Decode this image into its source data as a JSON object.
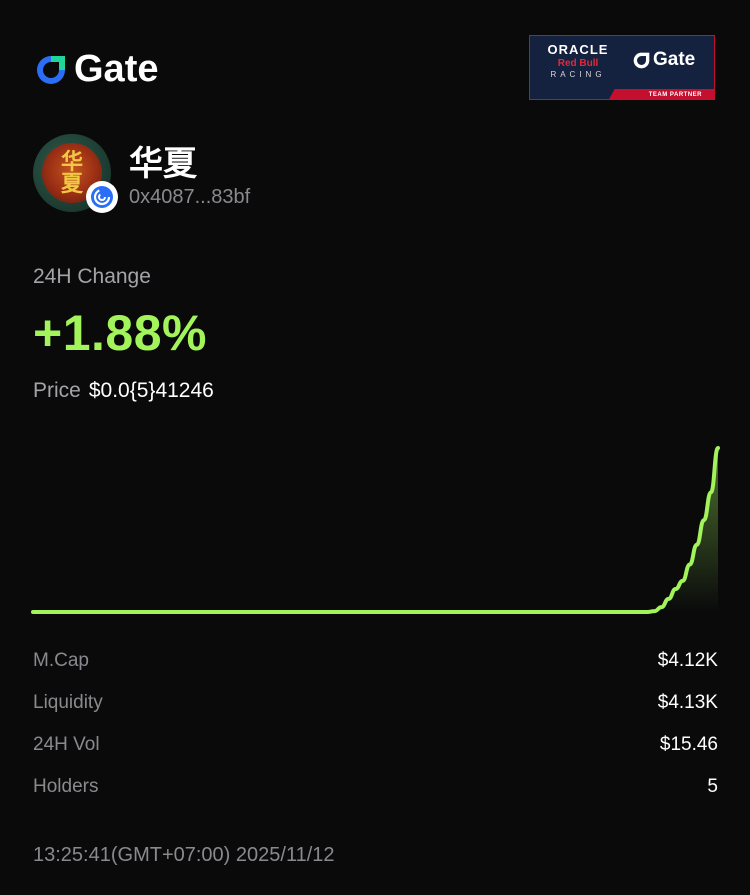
{
  "brand": {
    "name": "Gate",
    "accent_blue": "#2b6ef6",
    "accent_green": "#20d59a",
    "logo_icon": "gate-logo-icon"
  },
  "partner_badge": {
    "line1": "ORACLE",
    "line2": "Red Bull",
    "line3": "RACING",
    "brand": "Gate",
    "tag": "TEAM PARTNER"
  },
  "token": {
    "name": "华夏",
    "avatar_chars": [
      "华",
      "夏"
    ],
    "address": "0x4087...83bf",
    "chain_icon": "chain-badge-icon"
  },
  "change": {
    "label": "24H Change",
    "value": "+1.88%",
    "color": "#a3f35b"
  },
  "price": {
    "label": "Price",
    "value": "$0.0{5}41246"
  },
  "chart_data": {
    "type": "area",
    "color": "#a3f35b",
    "values": [
      0,
      0,
      0,
      0,
      0,
      0,
      0,
      0,
      0,
      0,
      0,
      0,
      0,
      0,
      0,
      0,
      0,
      0,
      0,
      0,
      0,
      0,
      0,
      0,
      0,
      0,
      0,
      0,
      0,
      0,
      0,
      0,
      0,
      0,
      0,
      0,
      0,
      0,
      0,
      0,
      0,
      0,
      0,
      0,
      0,
      0,
      0,
      0,
      0,
      0,
      0,
      0,
      0,
      0,
      0,
      0,
      0,
      0,
      0,
      0,
      0,
      0,
      0,
      0,
      0,
      0,
      0,
      0,
      0,
      0,
      0,
      0,
      0,
      0,
      0,
      0,
      0,
      0,
      0,
      0,
      0,
      0,
      0,
      0,
      0,
      0,
      0,
      0,
      0.5,
      3,
      8,
      14,
      19,
      29,
      41,
      56,
      73,
      100
    ]
  },
  "stats": [
    {
      "label": "M.Cap",
      "value": "$4.12K"
    },
    {
      "label": "Liquidity",
      "value": "$4.13K"
    },
    {
      "label": "24H Vol",
      "value": "$15.46"
    },
    {
      "label": "Holders",
      "value": "5"
    }
  ],
  "timestamp": "13:25:41(GMT+07:00) 2025/11/12"
}
